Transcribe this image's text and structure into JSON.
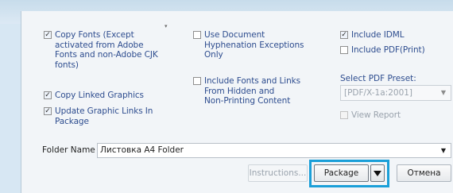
{
  "options": {
    "copy_fonts": {
      "label": "Copy Fonts (Except\nactivated from Adobe\nFonts and non-Adobe CJK\nfonts)",
      "checked": true
    },
    "copy_linked_graphics": {
      "label": "Copy Linked Graphics",
      "checked": true
    },
    "update_graphic_links": {
      "label": "Update Graphic Links In\nPackage",
      "checked": true
    },
    "use_doc_hyphenation": {
      "label": "Use Document\nHyphenation Exceptions\nOnly",
      "checked": false
    },
    "include_hidden_fonts": {
      "label": "Include Fonts and Links\nFrom Hidden and\nNon-Printing Content",
      "checked": false
    },
    "include_idml": {
      "label": "Include IDML",
      "checked": true
    },
    "include_pdf": {
      "label": "Include PDF(Print)",
      "checked": false
    },
    "view_report": {
      "label": "View Report",
      "checked": false
    }
  },
  "pdf_preset": {
    "label": "Select PDF Preset:",
    "value": "[PDF/X-1a:2001]"
  },
  "folder": {
    "label": "Folder Name",
    "value": "Листовка А4 Folder"
  },
  "buttons": {
    "instructions": "Instructions...",
    "package": "Package",
    "cancel": "Отмена"
  },
  "icons": {
    "dropdown": "chevron-down-icon",
    "check": "checkmark-icon"
  },
  "colors": {
    "label_blue": "#2e4d8f",
    "highlight": "#1a9fd8"
  }
}
